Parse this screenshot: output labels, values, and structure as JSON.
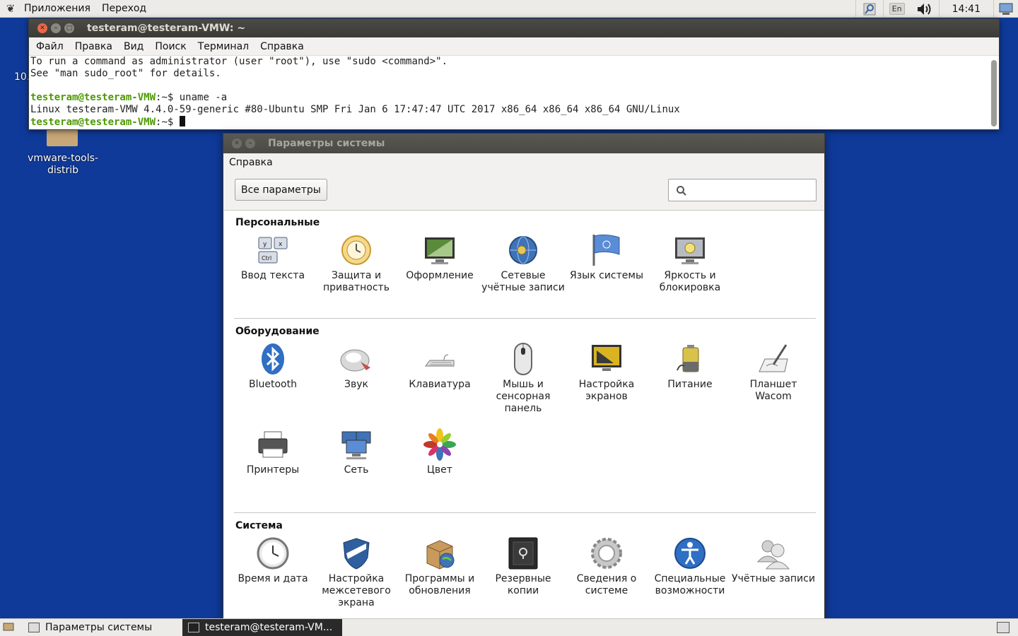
{
  "top_panel": {
    "menus": [
      "Приложения",
      "Переход"
    ],
    "keyboard_layout": "En",
    "clock": "14:41"
  },
  "desktop": {
    "partial_label": "10.",
    "folder_label_1": "vmware-tools-",
    "folder_label_2": "distrib"
  },
  "terminal": {
    "title": "testeram@testeram-VMW: ~",
    "menu": [
      "Файл",
      "Правка",
      "Вид",
      "Поиск",
      "Терминал",
      "Справка"
    ],
    "line1": "To run a command as administrator (user \"root\"), use \"sudo <command>\".",
    "line2": "See \"man sudo_root\" for details.",
    "prompt_user": "testeram@testeram-VMW",
    "prompt_path": ":~$ ",
    "command": "uname -a",
    "output": "Linux testeram-VMW 4.4.0-59-generic #80-Ubuntu SMP Fri Jan 6 17:47:47 UTC 2017 x86_64 x86_64 x86_64 GNU/Linux"
  },
  "settings": {
    "title": "Параметры системы",
    "menu_help": "Справка",
    "all_settings_button": "Все параметры",
    "search_placeholder": "",
    "sections": [
      {
        "title": "Персональные",
        "items": [
          {
            "label": "Ввод текста",
            "icon": "text-entry-icon"
          },
          {
            "label": "Защита и приватность",
            "icon": "security-privacy-icon"
          },
          {
            "label": "Оформление",
            "icon": "appearance-icon"
          },
          {
            "label": "Сетевые учётные записи",
            "icon": "online-accounts-icon"
          },
          {
            "label": "Язык системы",
            "icon": "language-flag-icon"
          },
          {
            "label": "Яркость и блокировка",
            "icon": "brightness-lock-icon"
          }
        ]
      },
      {
        "title": "Оборудование",
        "items": [
          {
            "label": "Bluetooth",
            "icon": "bluetooth-icon"
          },
          {
            "label": "Звук",
            "icon": "sound-icon"
          },
          {
            "label": "Клавиатура",
            "icon": "keyboard-icon"
          },
          {
            "label": "Мышь и сенсорная панель",
            "icon": "mouse-icon"
          },
          {
            "label": "Настройка экранов",
            "icon": "displays-icon"
          },
          {
            "label": "Питание",
            "icon": "power-battery-icon"
          },
          {
            "label": "Планшет Wacom",
            "icon": "wacom-tablet-icon"
          },
          {
            "label": "Принтеры",
            "icon": "printer-icon"
          },
          {
            "label": "Сеть",
            "icon": "network-icon"
          },
          {
            "label": "Цвет",
            "icon": "color-icon"
          }
        ]
      },
      {
        "title": "Система",
        "items": [
          {
            "label": "Время и дата",
            "icon": "clock-icon"
          },
          {
            "label": "Настройка межсетевого экрана",
            "icon": "firewall-shield-icon"
          },
          {
            "label": "Программы и обновления",
            "icon": "software-updates-icon"
          },
          {
            "label": "Резервные копии",
            "icon": "backup-safe-icon"
          },
          {
            "label": "Сведения о системе",
            "icon": "system-info-gear-icon"
          },
          {
            "label": "Специальные возможности",
            "icon": "accessibility-icon"
          },
          {
            "label": "Учётные записи",
            "icon": "user-accounts-icon"
          }
        ]
      }
    ]
  },
  "taskbar": {
    "items": [
      "Параметры системы",
      "testeram@testeram-VM..."
    ]
  }
}
